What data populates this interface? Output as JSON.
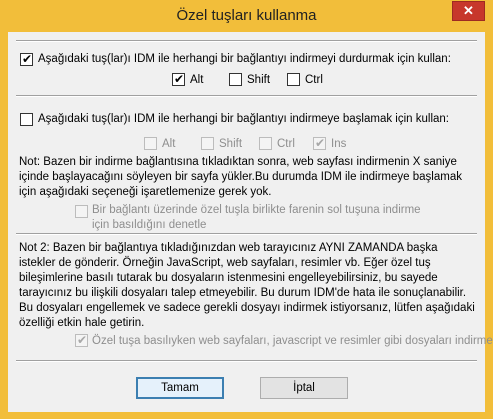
{
  "window": {
    "title": "Özel tuşları kullanma",
    "close_glyph": "✕",
    "close_color": "#C7372B",
    "frame_color": "#F2BE3A"
  },
  "section1": {
    "main_checkbox": {
      "label": "Aşağıdaki tuş(lar)ı IDM ile herhangi bir bağlantıyı indirmeyi durdurmak için kullan:",
      "checked": true
    },
    "keys": [
      {
        "label": "Alt",
        "checked": true
      },
      {
        "label": "Shift",
        "checked": false
      },
      {
        "label": "Ctrl",
        "checked": false
      }
    ]
  },
  "section2": {
    "main_checkbox": {
      "label": "Aşağıdaki tuş(lar)ı IDM ile herhangi bir bağlantıyı indirmeye başlamak için kullan:",
      "checked": false
    },
    "keys": [
      {
        "label": "Alt",
        "checked": false,
        "enabled": false
      },
      {
        "label": "Shift",
        "checked": false,
        "enabled": false
      },
      {
        "label": "Ctrl",
        "checked": false,
        "enabled": false
      },
      {
        "label": "Ins",
        "checked": true,
        "enabled": false
      }
    ],
    "note": "Not: Bazen bir indirme bağlantısına tıkladıktan sonra, web sayfası indirmenin X saniye içinde başlayacağını söyleyen bir sayfa yükler.Bu durumda IDM ile indirmeye başlamak için aşağıdaki seçeneği işaretlemenize gerek yok.",
    "sub_option": {
      "label": "Bir bağlantı üzerinde özel tuşla birlikte farenin sol tuşuna indirme için basıldığını denetle",
      "checked": false,
      "enabled": false
    }
  },
  "note2": "Not 2: Bazen bir bağlantıya tıkladığınızdan web tarayıcınız AYNI ZAMANDA başka istekler de gönderir. Örneğin JavaScript, web sayfaları, resimler vb. Eğer özel tuş bileşimlerine basılı tutarak bu dosyaların istenmesini engelleyebilirsiniz, bu sayede tarayıcınız bu ilişkili dosyaları talep etmeyebilir. Bu durum IDM'de hata ile sonuçlanabilir. Bu dosyaları engellemek ve sadece gerekli dosyayı indirmek istiyorsanız, lütfen aşağıdaki özelliği etkin hale getirin.",
  "block_option": {
    "label": "Özel tuşa basılıyken web sayfaları, javascript ve resimler gibi dosyaları indirme.",
    "checked": true,
    "enabled": false
  },
  "buttons": {
    "ok": "Tamam",
    "cancel": "İptal"
  }
}
